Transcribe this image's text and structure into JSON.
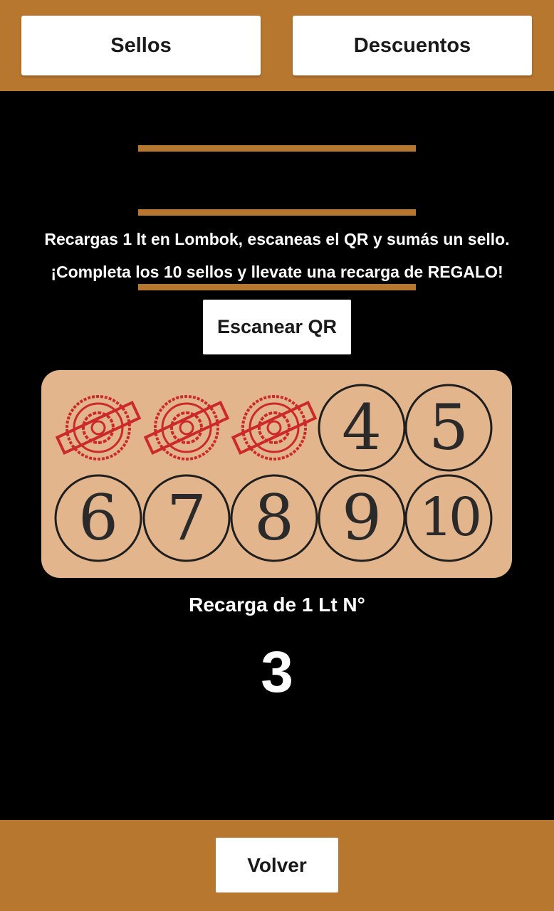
{
  "colors": {
    "accent": "#B8772E",
    "card": "#E2B58C",
    "background": "#000000",
    "stamp_red": "#CC2A2A"
  },
  "tabs": {
    "sellos": "Sellos",
    "descuentos": "Descuentos"
  },
  "info": {
    "line1": "Recargas 1 lt en Lombok, escaneas el QR y sumás un sello.",
    "line2": "¡Completa los 10 sellos y llevate una recarga de REGALO!"
  },
  "scan_button": "Escanear QR",
  "stamps": {
    "total": 10,
    "collected": 3,
    "items": [
      {
        "number": "1",
        "stamped": true
      },
      {
        "number": "2",
        "stamped": true
      },
      {
        "number": "3",
        "stamped": true
      },
      {
        "number": "4",
        "stamped": false
      },
      {
        "number": "5",
        "stamped": false
      },
      {
        "number": "6",
        "stamped": false
      },
      {
        "number": "7",
        "stamped": false
      },
      {
        "number": "8",
        "stamped": false
      },
      {
        "number": "9",
        "stamped": false
      },
      {
        "number": "10",
        "stamped": false
      }
    ]
  },
  "recarga": {
    "label": "Recarga de 1 Lt N°",
    "number": "3"
  },
  "back_button": "Volver"
}
